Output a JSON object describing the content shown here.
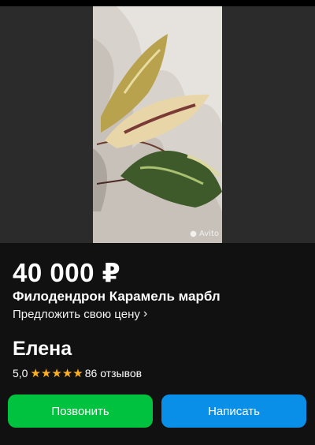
{
  "listing": {
    "photo_watermark": "Avito",
    "price": "40 000 ₽",
    "title": "Филодендрон Карамель марбл",
    "offer_link": "Предложить свою цену",
    "offer_chevron": "›"
  },
  "seller": {
    "name": "Елена",
    "rating": "5,0",
    "stars": 5,
    "reviews": "86 отзывов"
  },
  "actions": {
    "call_label": "Позвонить",
    "write_label": "Написать"
  },
  "colors": {
    "background": "#111111",
    "star": "#ffb021",
    "call_button": "#00c23e",
    "write_button": "#0a8fe9"
  }
}
